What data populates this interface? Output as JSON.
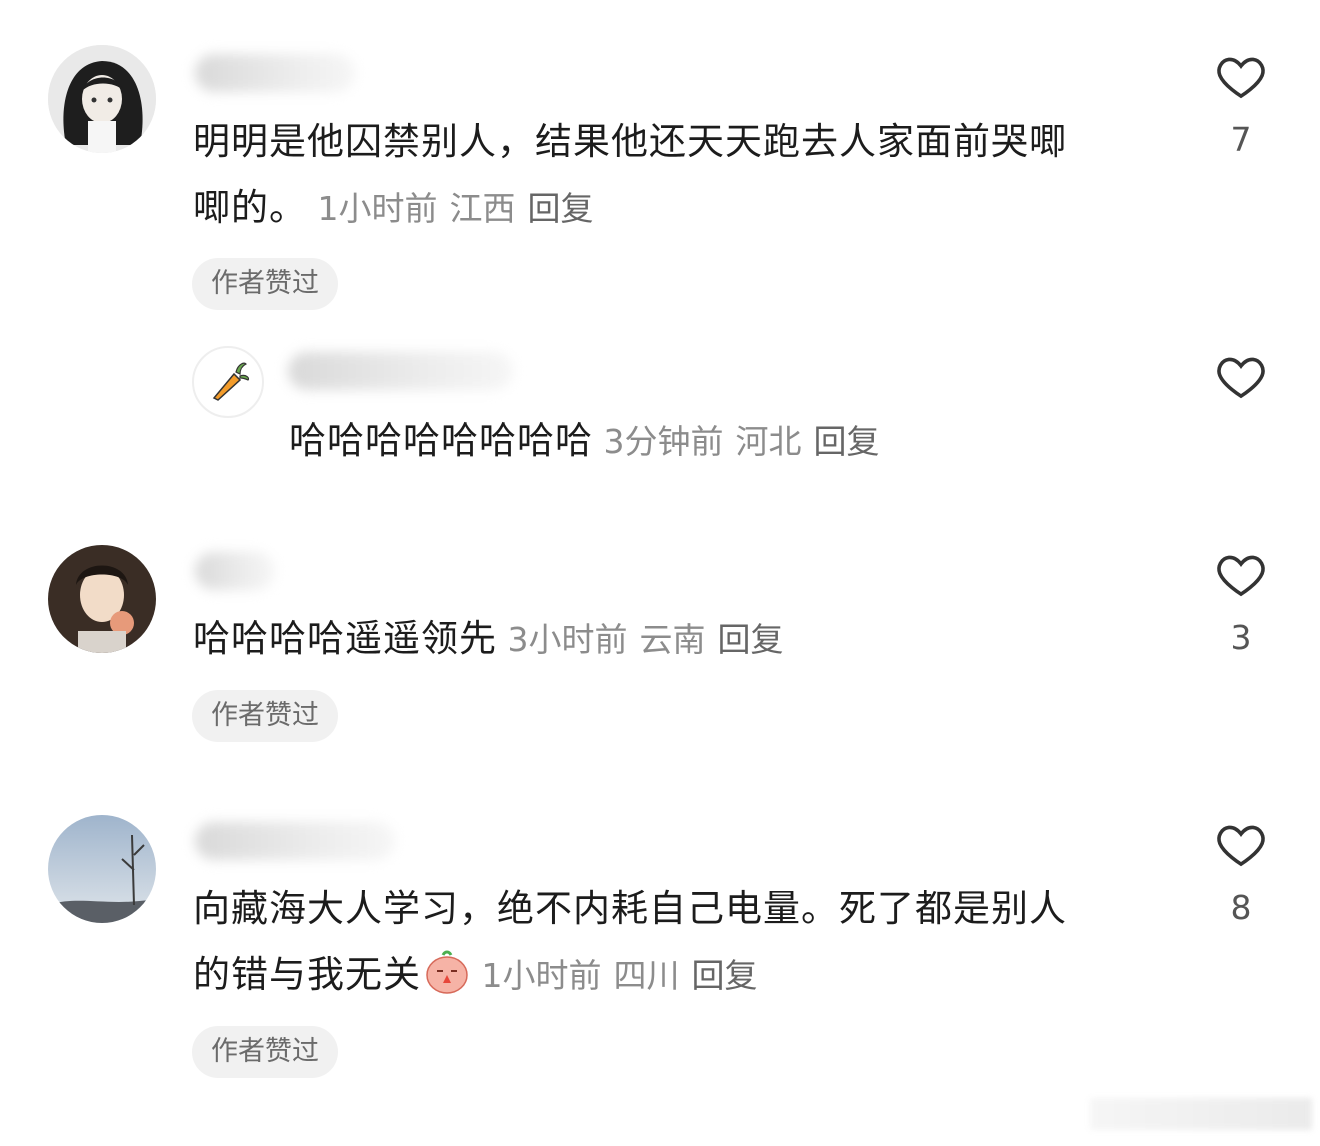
{
  "comments": [
    {
      "text_line1": "明明是他囚禁别人，结果他还天天跑去人家面前哭唧",
      "text_line2": "唧的。",
      "time": "1小时前",
      "location": "江西",
      "reply_label": "回复",
      "author_liked": "作者赞过",
      "likes": "7"
    },
    {
      "text": "哈哈哈哈哈哈哈哈",
      "time": "3分钟前",
      "location": "河北",
      "reply_label": "回复"
    },
    {
      "text": "哈哈哈哈遥遥领先",
      "time": "3小时前",
      "location": "云南",
      "reply_label": "回复",
      "author_liked": "作者赞过",
      "likes": "3"
    },
    {
      "text_line1": "向藏海大人学习，绝不内耗自己电量。死了都是别人",
      "text_line2": "的错与我无关",
      "time": "1小时前",
      "location": "四川",
      "reply_label": "回复",
      "author_liked": "作者赞过",
      "likes": "8"
    }
  ],
  "icons": {
    "like": "heart-outline-icon",
    "emoji": "praying-face-emoji",
    "reply_avatar": "carrot-icon"
  }
}
